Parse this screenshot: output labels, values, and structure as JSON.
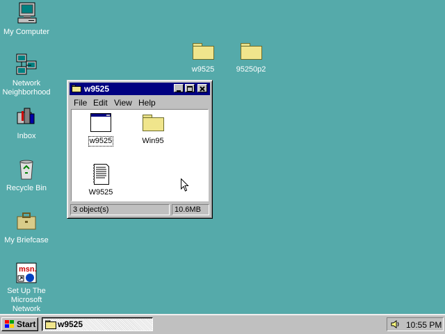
{
  "desktop": {
    "background_color": "#55aaaa",
    "icons": [
      {
        "label": "My Computer",
        "icon": "computer-icon"
      },
      {
        "label": "Network Neighborhood",
        "icon": "network-icon"
      },
      {
        "label": "Inbox",
        "icon": "inbox-icon"
      },
      {
        "label": "Recycle Bin",
        "icon": "recycle-bin-icon"
      },
      {
        "label": "My Briefcase",
        "icon": "briefcase-icon"
      },
      {
        "label": "Set Up The Microsoft Network",
        "icon": "msn-icon"
      },
      {
        "label": "w9525",
        "icon": "folder-icon"
      },
      {
        "label": "95250p2",
        "icon": "folder-icon"
      }
    ]
  },
  "window": {
    "title": "w9525",
    "title_color": "#000080",
    "menu": [
      "File",
      "Edit",
      "View",
      "Help"
    ],
    "items": [
      {
        "label": "w9525",
        "icon": "program-window-icon"
      },
      {
        "label": "Win95",
        "icon": "folder-icon"
      },
      {
        "label": "W9525",
        "icon": "text-document-icon"
      }
    ],
    "status": {
      "objects": "3 object(s)",
      "size": "10.6MB"
    }
  },
  "taskbar": {
    "start_label": "Start",
    "task_label": "w9525",
    "clock": "10:55 PM"
  }
}
